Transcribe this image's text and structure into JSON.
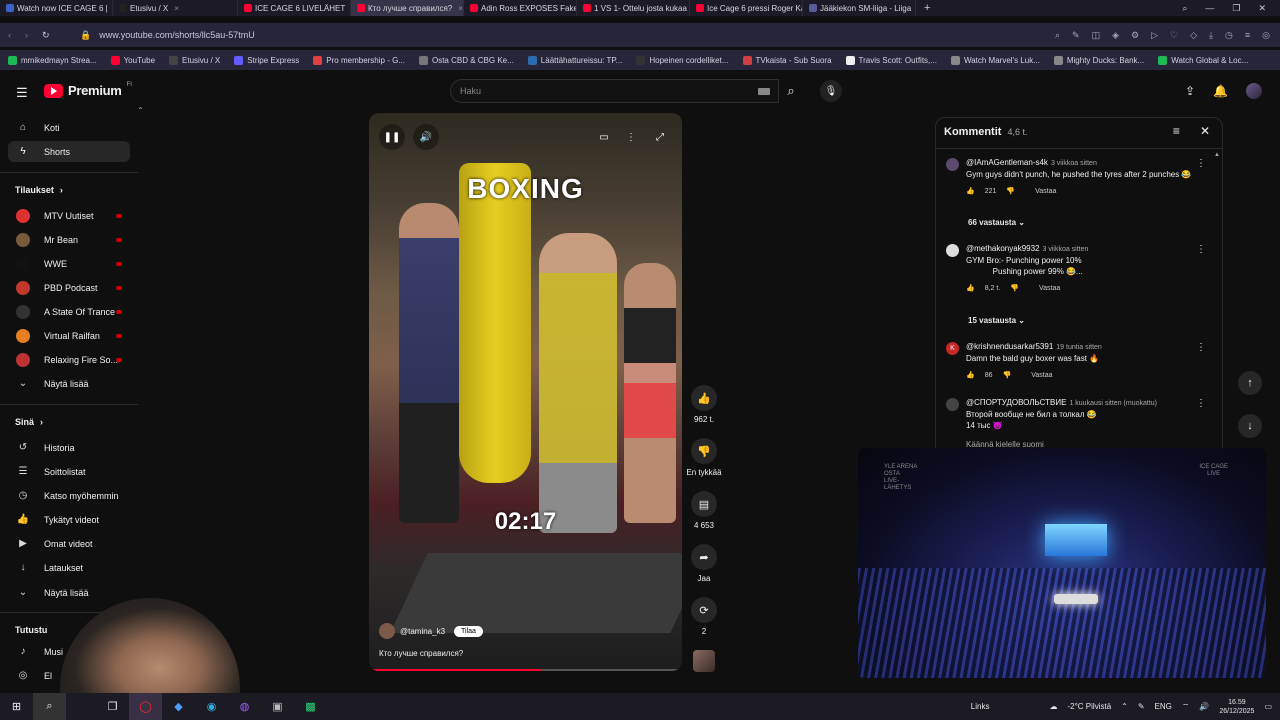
{
  "browser": {
    "tabs": [
      {
        "label": "Watch now ICE CAGE 6 |",
        "color": "#3a62c9",
        "active": false
      },
      {
        "label": "Etusivu / X",
        "color": "#222",
        "active": false
      },
      {
        "label": "ICE CAGE 6 LIVELÄHET",
        "color": "#ff0033",
        "active": false
      },
      {
        "label": "Кто лучше справился?",
        "color": "#ff0033",
        "active": true
      },
      {
        "label": "Adin Ross EXPOSES Fake C",
        "color": "#ff0033",
        "active": false
      },
      {
        "label": "1 VS 1- Ottelu josta kukaa",
        "color": "#ff0033",
        "active": false
      },
      {
        "label": "Ice Cage 6 pressi Roger Ka",
        "color": "#ff0033",
        "active": false
      },
      {
        "label": "Jääkiekon SM-liiga - Liiga",
        "color": "#5a5aa0",
        "active": false
      }
    ],
    "url": "www.youtube.com/shorts/llc5au-57tmU",
    "bookmarks": [
      {
        "label": "mmikedmayn Strea...",
        "color": "#1db954"
      },
      {
        "label": "YouTube",
        "color": "#ff0033"
      },
      {
        "label": "Etusivu / X",
        "color": "#444"
      },
      {
        "label": "Stripe Express",
        "color": "#635bff"
      },
      {
        "label": "Pro membership - G...",
        "color": "#e04040"
      },
      {
        "label": "Osta CBD & CBG Ke...",
        "color": "#777"
      },
      {
        "label": "Läättähattureissu: TP...",
        "color": "#2b6cb0"
      },
      {
        "label": "Hopeinen cordelliket...",
        "color": "#333"
      },
      {
        "label": "TVkaista - Sub Suora",
        "color": "#d04040"
      },
      {
        "label": "Travis Scott: Outfits,...",
        "color": "#eee"
      },
      {
        "label": "Watch Marvel's Luk...",
        "color": "#888"
      },
      {
        "label": "Mighty Ducks: Bank...",
        "color": "#888"
      },
      {
        "label": "Watch Global & Loc...",
        "color": "#1db954"
      }
    ]
  },
  "youtube": {
    "logo": "Premium",
    "region": "FI",
    "search_placeholder": "Haku"
  },
  "sidebar": {
    "home": "Koti",
    "shorts": "Shorts",
    "subs_heading": "Tilaukset",
    "channels": [
      {
        "label": "MTV Uutiset",
        "color": "#e03131"
      },
      {
        "label": "Mr Bean",
        "color": "#7a5a3a"
      },
      {
        "label": "WWE",
        "color": "#111"
      },
      {
        "label": "PBD Podcast",
        "color": "#c0392b"
      },
      {
        "label": "A State Of Trance",
        "color": "#333"
      },
      {
        "label": "Virtual Railfan",
        "color": "#e67e22"
      },
      {
        "label": "Relaxing Fire So...",
        "color": "#b33"
      }
    ],
    "show_more": "Näytä lisää",
    "you_heading": "Sinä",
    "you_items": [
      {
        "label": "Historia",
        "icon": "↺"
      },
      {
        "label": "Soittolistat",
        "icon": "☰"
      },
      {
        "label": "Katso myöhemmin",
        "icon": "◷"
      },
      {
        "label": "Tykätyt videot",
        "icon": "👍"
      },
      {
        "label": "Omat videot",
        "icon": "▶"
      },
      {
        "label": "Lataukset",
        "icon": "↓"
      }
    ],
    "show_more_2": "Näytä lisää",
    "explore_heading": "Tutustu",
    "explore_items": [
      {
        "label": "Musi"
      },
      {
        "label": "El"
      }
    ]
  },
  "video": {
    "title_overlay": "BOXING",
    "timer_overlay": "02:17",
    "channel": "@tamina_k3",
    "subscribe": "Tilaa",
    "caption": "Кто лучше справился?",
    "progress": 0.55
  },
  "actions": {
    "likes": "962 t.",
    "dislike_label": "En tykkää",
    "comments": "4 653",
    "share": "Jaa",
    "remix": "2"
  },
  "comments": {
    "title": "Kommentit",
    "count": "4,6 t.",
    "items": [
      {
        "author": "@IAmAGentleman-s4k",
        "ago": "3 viikkoa sitten",
        "text": "Gym guys didn't punch, he pushed the tyres after 2 punches 😂",
        "likes": "221",
        "reply": "Vastaa",
        "avatar_color": "#5b4a6b",
        "initial": ""
      },
      {
        "author": "@methakonyak9932",
        "ago": "3 viikkoa sitten",
        "text": "GYM Bro:- Punching power 10%\n            Pushing power 99% 😂...",
        "likes": "8,2 t.",
        "reply": "Vastaa",
        "avatar_color": "#ddd",
        "initial": ""
      },
      {
        "author": "@krishnendusarkar5391",
        "ago": "19 tuntia sitten",
        "text": "Damn the bald guy boxer was fast 🔥",
        "likes": "86",
        "reply": "Vastaa",
        "avatar_color": "#c62828",
        "initial": "K"
      },
      {
        "author": "@СПОРТУДОВОЛЬСТВИЕ",
        "ago": "1 kuukausi sitten (muokattu)",
        "text": "Второй вообще не бил а толкал 😂\n14 тыс 😈",
        "likes": "",
        "reply": "",
        "avatar_color": "#444",
        "initial": ""
      }
    ],
    "reply_counts": [
      "66 vastausta",
      "15 vastausta"
    ],
    "translate": "Käännä kielelle suomi"
  },
  "pip": {
    "logo_left": "YLE ARENA\nOSTA\nLIVE-\nLÄHETYS",
    "logo_right": "ICE CAGE\nLIVE"
  },
  "taskbar": {
    "links": "Links",
    "weather": "-2°C Pilvistä",
    "lang": "ENG",
    "time": "16.59",
    "date": "26/12/2025"
  }
}
